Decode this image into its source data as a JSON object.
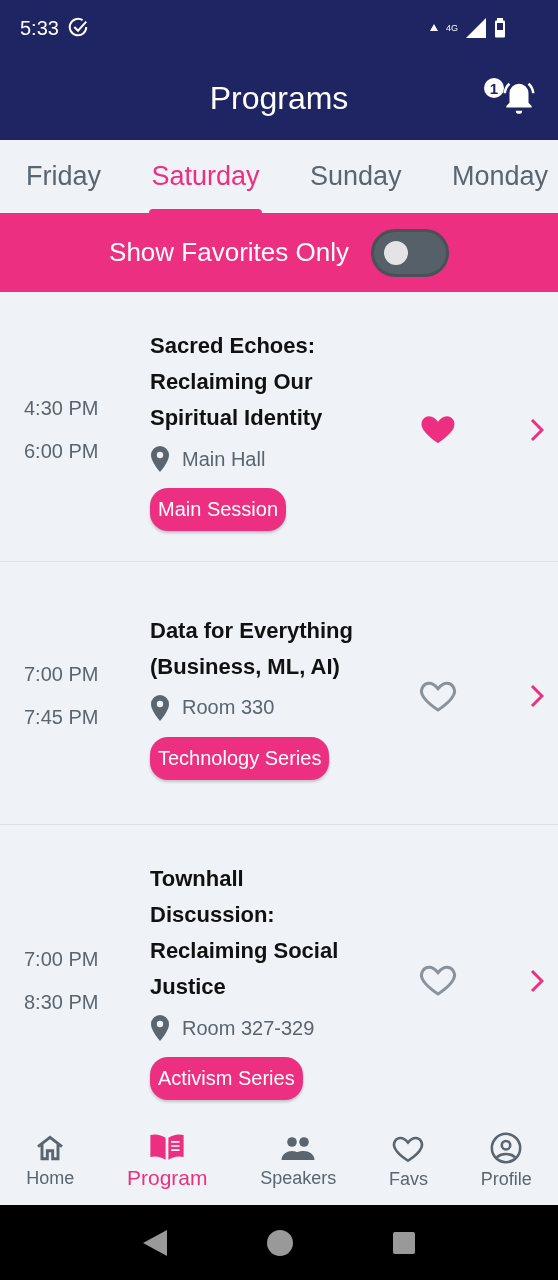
{
  "status_bar": {
    "time": "5:33",
    "network": "4G"
  },
  "header": {
    "title": "Programs",
    "notification_count": "1"
  },
  "tabs": [
    {
      "label": "Friday",
      "selected": false
    },
    {
      "label": "Saturday",
      "selected": true
    },
    {
      "label": "Sunday",
      "selected": false
    },
    {
      "label": "Monday",
      "selected": false
    }
  ],
  "favorites_filter": {
    "label": "Show Favorites Only",
    "on": false
  },
  "sessions": [
    {
      "start": "4:30 PM",
      "end": "6:00 PM",
      "title": "Sacred Echoes: Reclaiming Our Spiritual Identity",
      "location": "Main Hall",
      "tag": "Main Session",
      "favorite": true
    },
    {
      "start": "7:00 PM",
      "end": "7:45 PM",
      "title": "Data for Everything (Business, ML, AI)",
      "location": "Room 330",
      "tag": "Technology Series",
      "favorite": false
    },
    {
      "start": "7:00 PM",
      "end": "8:30 PM",
      "title": "Townhall Discussion: Reclaiming Social Justice",
      "location": "Room 327-329",
      "tag": "Activism Series",
      "favorite": false
    }
  ],
  "bottom_nav": [
    {
      "label": "Home",
      "kind": "home",
      "selected": false
    },
    {
      "label": "Program",
      "kind": "book",
      "selected": true
    },
    {
      "label": "Speakers",
      "kind": "people",
      "selected": false
    },
    {
      "label": "Favs",
      "kind": "heart",
      "selected": false
    },
    {
      "label": "Profile",
      "kind": "profile",
      "selected": false
    }
  ]
}
